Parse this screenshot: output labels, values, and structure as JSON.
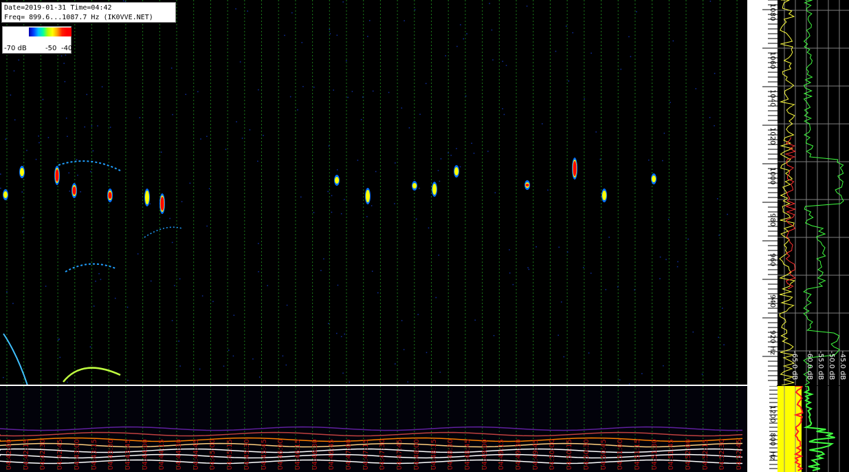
{
  "header": {
    "date_line": "Date=2019-01-31 Time=04:42",
    "freq_line": "Freq= 899.6...1087.7 Hz (IK0VVE.NET)"
  },
  "legend": {
    "min_label": "-70 dB",
    "mid_label": "-50",
    "max_label": "-40"
  },
  "freq_scale": {
    "labels": [
      "1080",
      "1060",
      "1040",
      "1020",
      "1000",
      "980",
      "960",
      "940",
      "920",
      "Hz"
    ]
  },
  "db_scale": {
    "labels": [
      "-65.0 dB",
      "-60.0 dB",
      "-55.0 dB",
      "-50.0 dB",
      "-45.0 dB"
    ]
  },
  "lower_scale": {
    "labels": [
      "1200",
      "800",
      "Hz"
    ]
  },
  "time_axis": {
    "labels": [
      "04:42:00",
      "04:42:15",
      "04:42:30",
      "04:42:45",
      "04:43:00",
      "04:43:15",
      "04:43:30",
      "04:43:45",
      "04:44:00",
      "04:44:15",
      "04:44:30",
      "04:44:45",
      "04:45:00",
      "04:45:15",
      "04:45:30",
      "04:45:45",
      "04:46:00",
      "04:46:15",
      "04:46:30",
      "04:46:45",
      "04:47:00",
      "04:47:15",
      "04:47:30",
      "04:47:45",
      "04:48:00",
      "04:48:15",
      "04:48:30",
      "04:48:45",
      "04:49:00",
      "04:49:15",
      "04:49:30",
      "04:49:45",
      "04:50:00",
      "04:50:15",
      "04:50:30",
      "04:50:45",
      "04:51:00",
      "04:51:15",
      "04:51:30",
      "04:51:45",
      "04:52:00",
      "04:52:15",
      "04:52:30",
      "04:52:45"
    ]
  },
  "colors": {
    "gridline": "#1a7a1a",
    "signal_low": "#0060ff",
    "signal_mid": "#ffff00",
    "signal_high": "#ff0000",
    "spectrum_avg": "#40ff40",
    "spectrum_peak": "#ffff40",
    "time_label": "#c01010"
  }
}
